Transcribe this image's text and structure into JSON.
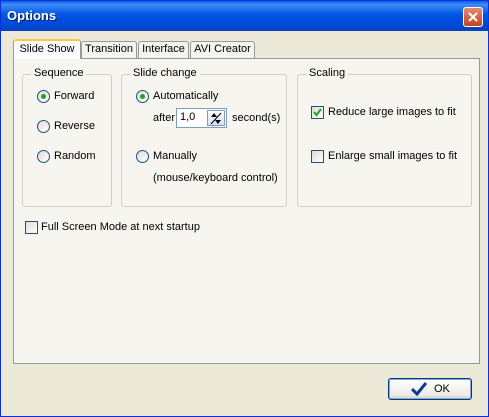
{
  "window": {
    "title": "Options"
  },
  "tabs": [
    "Slide Show",
    "Transition",
    "Interface",
    "AVI Creator"
  ],
  "sequence": {
    "title": "Sequence",
    "options": [
      "Forward",
      "Reverse",
      "Random"
    ],
    "selected": "Forward"
  },
  "slide_change": {
    "title": "Slide change",
    "automatic_label": "Automatically",
    "after_label": "after",
    "interval_value": "1,0",
    "seconds_label": "second(s)",
    "manual_label": "Manually",
    "manual_hint": "(mouse/keyboard control)",
    "selected": "Automatically"
  },
  "scaling": {
    "title": "Scaling",
    "reduce_label": "Reduce large images to fit",
    "reduce_checked": true,
    "enlarge_label": "Enlarge small images to fit",
    "enlarge_checked": false
  },
  "fullscreen": {
    "label": "Full Screen Mode at next startup",
    "checked": false
  },
  "buttons": {
    "ok_label": "OK"
  },
  "icons": {
    "close": "close-icon",
    "ok": "checkmark-icon",
    "spin": "spin-arrows-icon"
  }
}
